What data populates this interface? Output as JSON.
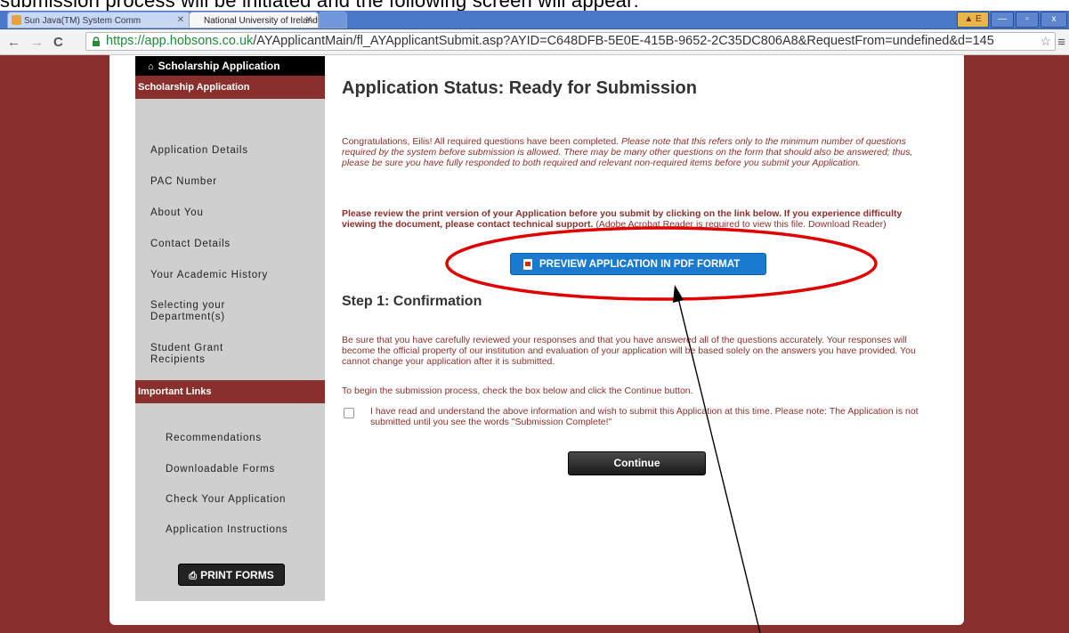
{
  "caption": "submission process will be initiated and the following screen will appear:",
  "browser": {
    "tabs": [
      {
        "label": "Sun Java(TM) System Comm"
      },
      {
        "label": "National University of Ireland"
      }
    ],
    "url_scheme": "https://",
    "url_host": "app.hobsons.co.uk",
    "url_path": "/AYApplicantMain/fl_AYApplicantSubmit.asp?AYID=C648DFB-5E0E-415B-9652-2C35DC806A8&RequestFrom=undefined&d=145",
    "window_controls": {
      "warn": "▲ E",
      "min": "—",
      "max": "▫",
      "close": "x"
    }
  },
  "sidebar": {
    "title": "Scholarship Application",
    "section1_heading": "Scholarship Application",
    "items": [
      {
        "label": "Application Details"
      },
      {
        "label": "PAC Number"
      },
      {
        "label": "About You"
      },
      {
        "label": "Contact Details"
      },
      {
        "label": "Your Academic History"
      },
      {
        "label": "Selecting your Department(s)"
      },
      {
        "label": "Student Grant Recipients"
      }
    ],
    "section2_heading": "Important Links",
    "links": [
      {
        "label": "Recommendations"
      },
      {
        "label": "Downloadable Forms"
      },
      {
        "label": "Check Your Application"
      },
      {
        "label": "Application Instructions"
      }
    ],
    "print_button": "PRINT FORMS"
  },
  "main": {
    "title": "Application Status: Ready for Submission",
    "intro_plain": "Congratulations, Eilis! All required questions have been completed.",
    "intro_italic": "Please note that this refers only to the minimum number of questions required by the system before submission is allowed. There may be many other questions on the form that should also be answered; thus, please be sure you have fully responded to both required and relevant non-required items before you submit your Application.",
    "review_bold": "Please review the print version of your Application before you submit by clicking on the link below. If you experience difficulty viewing the document, please contact technical support.",
    "review_plain": "(Adobe Acrobat Reader is required to view this file. Download Reader)",
    "pdf_button": "PREVIEW APPLICATION IN PDF FORMAT",
    "step_heading": "Step 1: Confirmation",
    "confirm_text": "Be sure that you have carefully reviewed your responses and that you have answered all of the questions accurately. Your responses will become the official property of our institution and evaluation of your application will be based solely on the answers you have provided. You cannot change your application after it is submitted.",
    "begin_text": "To begin the submission process, check the box below and click the Continue button.",
    "checkbox_label": "I have read and understand the above information and wish to submit this Application at this time. Please note: The Application is not submitted until you see the words \"Submission Complete!\"",
    "continue_button": "Continue"
  },
  "colors": {
    "brand": "#8a302c",
    "button_blue": "#1a7ad0",
    "annotation_red": "#e00000"
  }
}
